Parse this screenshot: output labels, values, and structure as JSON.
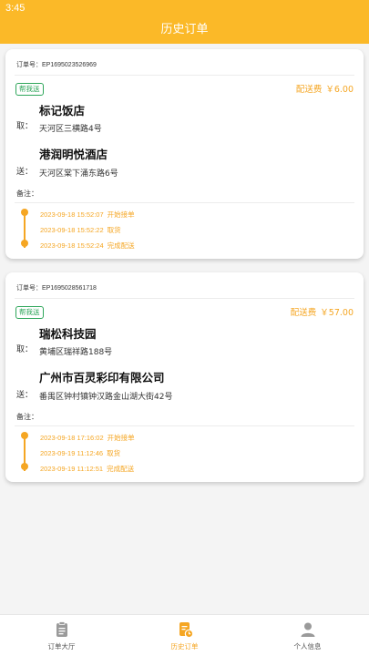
{
  "status": {
    "time": "3:45"
  },
  "header": {
    "title": "历史订单"
  },
  "orders": [
    {
      "order_no": "订单号：EP1695023526969",
      "tag": "帮我送",
      "fee_label": "配送费",
      "fee_value": "￥6.00",
      "pickup": {
        "label": "取：",
        "name": "标记饭店",
        "addr": "天河区三横路4号"
      },
      "dropoff": {
        "label": "送：",
        "name": "港润明悦酒店",
        "addr": "天河区棠下涌东路6号"
      },
      "note_label": "备注：",
      "events": [
        {
          "time": "2023-09-18 15:52:07",
          "text": "开始接单"
        },
        {
          "time": "2023-09-18 15:52:22",
          "text": "取货"
        },
        {
          "time": "2023-09-18 15:52:24",
          "text": "完成配送"
        }
      ]
    },
    {
      "order_no": "订单号：EP1695028561718",
      "tag": "帮我送",
      "fee_label": "配送费",
      "fee_value": "￥57.00",
      "pickup": {
        "label": "取：",
        "name": "瑞松科技园",
        "addr": "黄埔区瑞祥路188号"
      },
      "dropoff": {
        "label": "送：",
        "name": "广州市百灵彩印有限公司",
        "addr": "番禺区钟村镇钟汉路金山湖大街42号"
      },
      "note_label": "备注：",
      "events": [
        {
          "time": "2023-09-18 17:16:02",
          "text": "开始接单"
        },
        {
          "time": "2023-09-19 11:12:46",
          "text": "取货"
        },
        {
          "time": "2023-09-19 11:12:51",
          "text": "完成配送"
        }
      ]
    }
  ],
  "tabs": [
    {
      "label": "订单大厅",
      "icon": "clipboard-icon"
    },
    {
      "label": "历史订单",
      "icon": "history-order-icon"
    },
    {
      "label": "个人信息",
      "icon": "user-icon"
    }
  ],
  "colors": {
    "brand": "#fbb928",
    "accent": "#f5a623",
    "tag_green": "#2ea65a"
  }
}
